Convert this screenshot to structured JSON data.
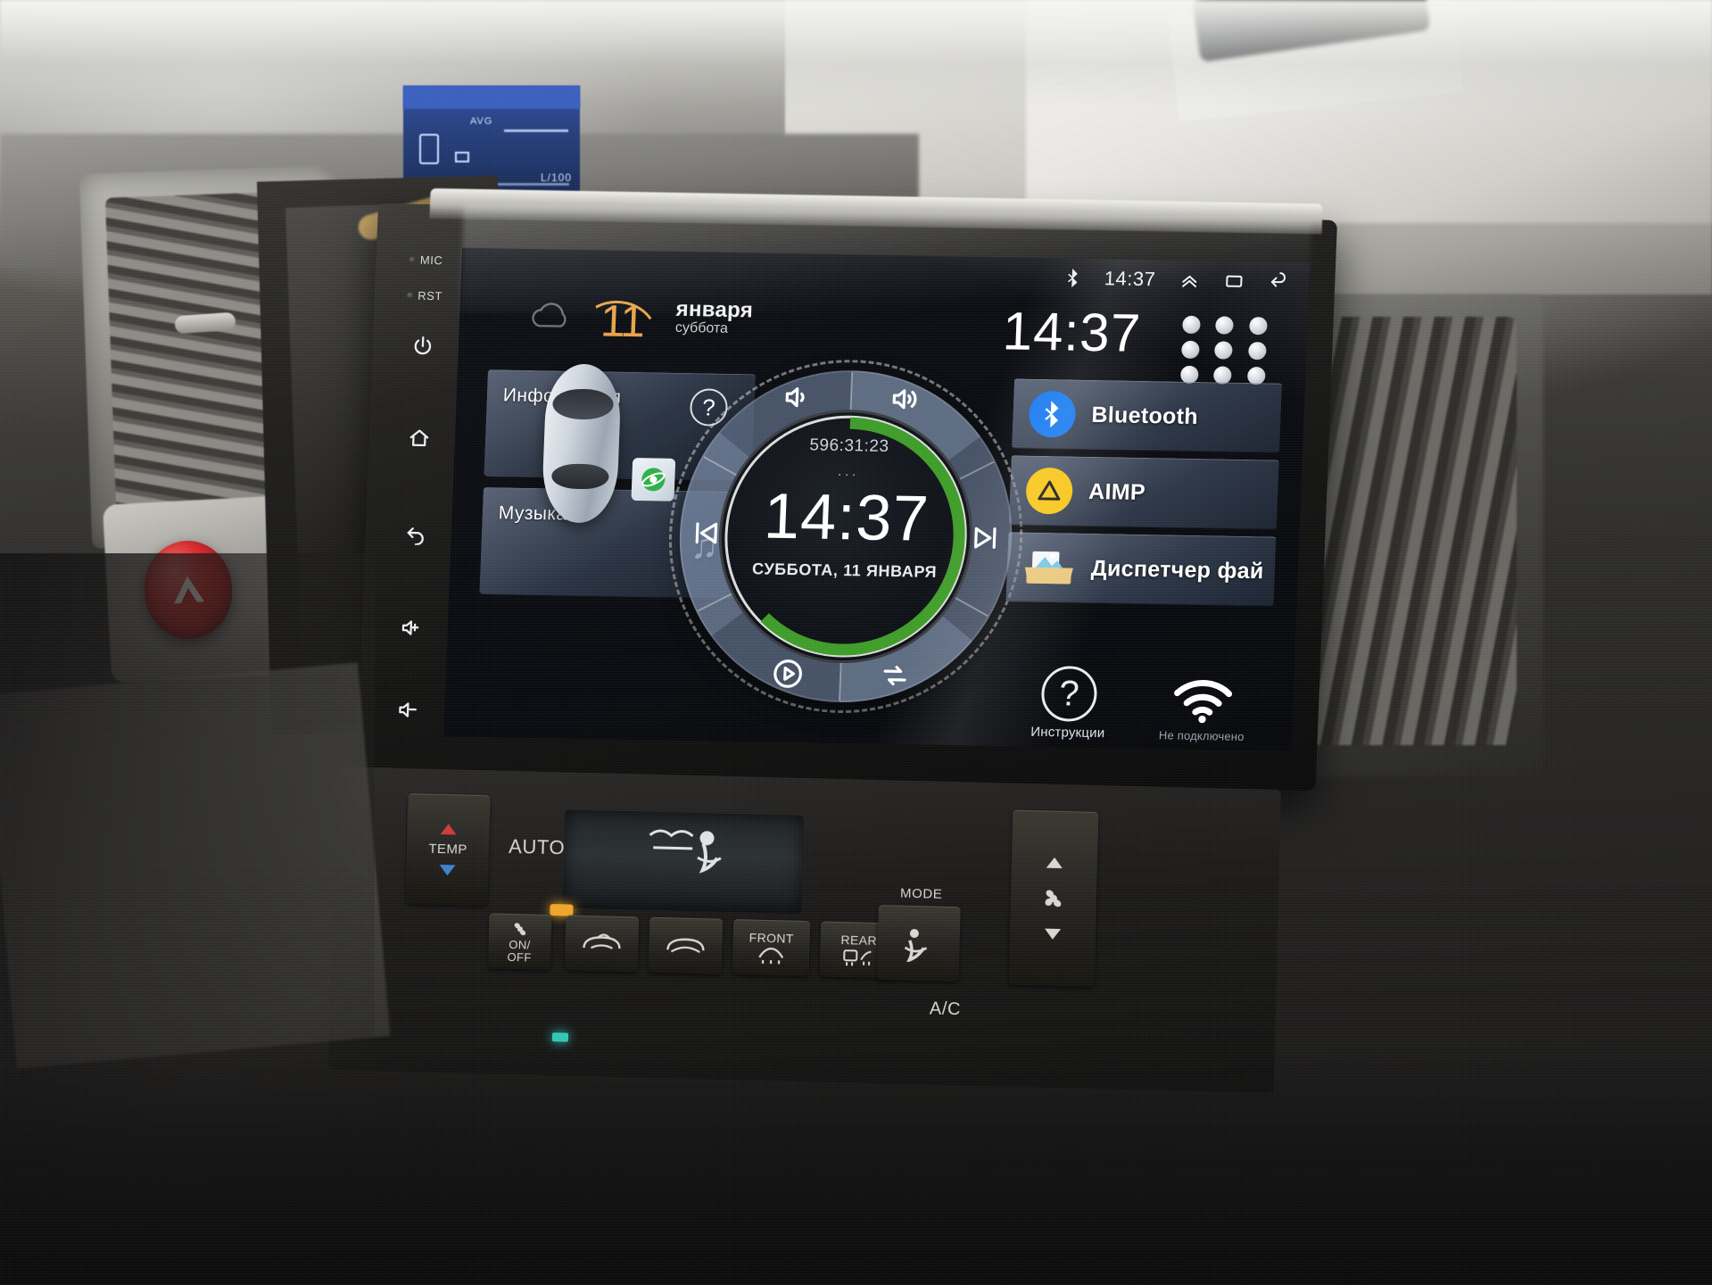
{
  "photo": {
    "subject": "car-dashboard-with-android-head-unit",
    "vehicle_area_labels": {
      "mid_display_avg": "AVG",
      "mid_display_unit": "L/100"
    }
  },
  "head_unit": {
    "side_keys": [
      {
        "name": "mic-pinhole",
        "label": "MIC"
      },
      {
        "name": "reset-pinhole",
        "label": "RST"
      },
      {
        "name": "power-key",
        "label": ""
      },
      {
        "name": "home-key",
        "label": ""
      },
      {
        "name": "back-key",
        "label": ""
      },
      {
        "name": "volume-up-key",
        "label": ""
      },
      {
        "name": "volume-down-key",
        "label": ""
      }
    ],
    "status_bar": {
      "bluetooth_icon": "bluetooth-icon",
      "time": "14:37",
      "expand_icon": "chevron-up-icon",
      "recents_icon": "recents-icon",
      "back_icon": "back-arrow-icon"
    },
    "header": {
      "day_number": "11",
      "month": "января",
      "weekday": "суббота",
      "clock": "14:37",
      "app_drawer_icon": "app-grid-icon"
    },
    "left_widgets": [
      {
        "name": "car-info-widget",
        "label": "Информация",
        "help_icon": "question-mark-icon",
        "badge_icon": "navigation-globe-icon"
      },
      {
        "name": "music-widget",
        "label": "Музыка",
        "icon": "music-note-icon"
      }
    ],
    "dial": {
      "elapsed": "596:31:23",
      "dots": "...",
      "time": "14:37",
      "date": "СУББОТА, 11 ЯНВАРЯ",
      "progress_percent": 62,
      "accent_color": "#3f9c29",
      "controls": [
        {
          "name": "volume-down-button",
          "icon": "volume-low-icon"
        },
        {
          "name": "volume-up-button",
          "icon": "volume-high-icon"
        },
        {
          "name": "previous-track-button",
          "icon": "prev-track-icon"
        },
        {
          "name": "next-track-button",
          "icon": "next-track-icon"
        },
        {
          "name": "play-button",
          "icon": "play-icon"
        },
        {
          "name": "repeat-button",
          "icon": "repeat-icon"
        }
      ]
    },
    "apps": [
      {
        "name": "app-bluetooth",
        "label": "Bluetooth",
        "icon": "bluetooth-icon",
        "color": "#1a7cf0"
      },
      {
        "name": "app-aimp",
        "label": "AIMP",
        "icon": "aimp-icon",
        "color": "#f7c518"
      },
      {
        "name": "app-file-manager",
        "label": "Диспетчер фай",
        "icon": "file-manager-icon",
        "color": "#e6c07a"
      }
    ],
    "shortcuts": [
      {
        "name": "instructions-shortcut",
        "label": "Инструкции",
        "icon": "question-mark-icon"
      },
      {
        "name": "wifi-shortcut",
        "label": "Не подключено",
        "icon": "wifi-icon"
      }
    ]
  },
  "climate": {
    "temp_label": "TEMP",
    "auto_label": "AUTO",
    "fan_onoff_label": "ON/\nOFF",
    "mode_label": "MODE",
    "front_defrost_label": "FRONT",
    "rear_defrost_label": "REAR",
    "ac_label": "A/C",
    "recirc_icon": "recirculation-icon",
    "fresh_air_icon": "fresh-air-icon",
    "fan_icon": "fan-icon",
    "up_icon": "triangle-up-icon",
    "down_icon": "triangle-down-icon"
  }
}
